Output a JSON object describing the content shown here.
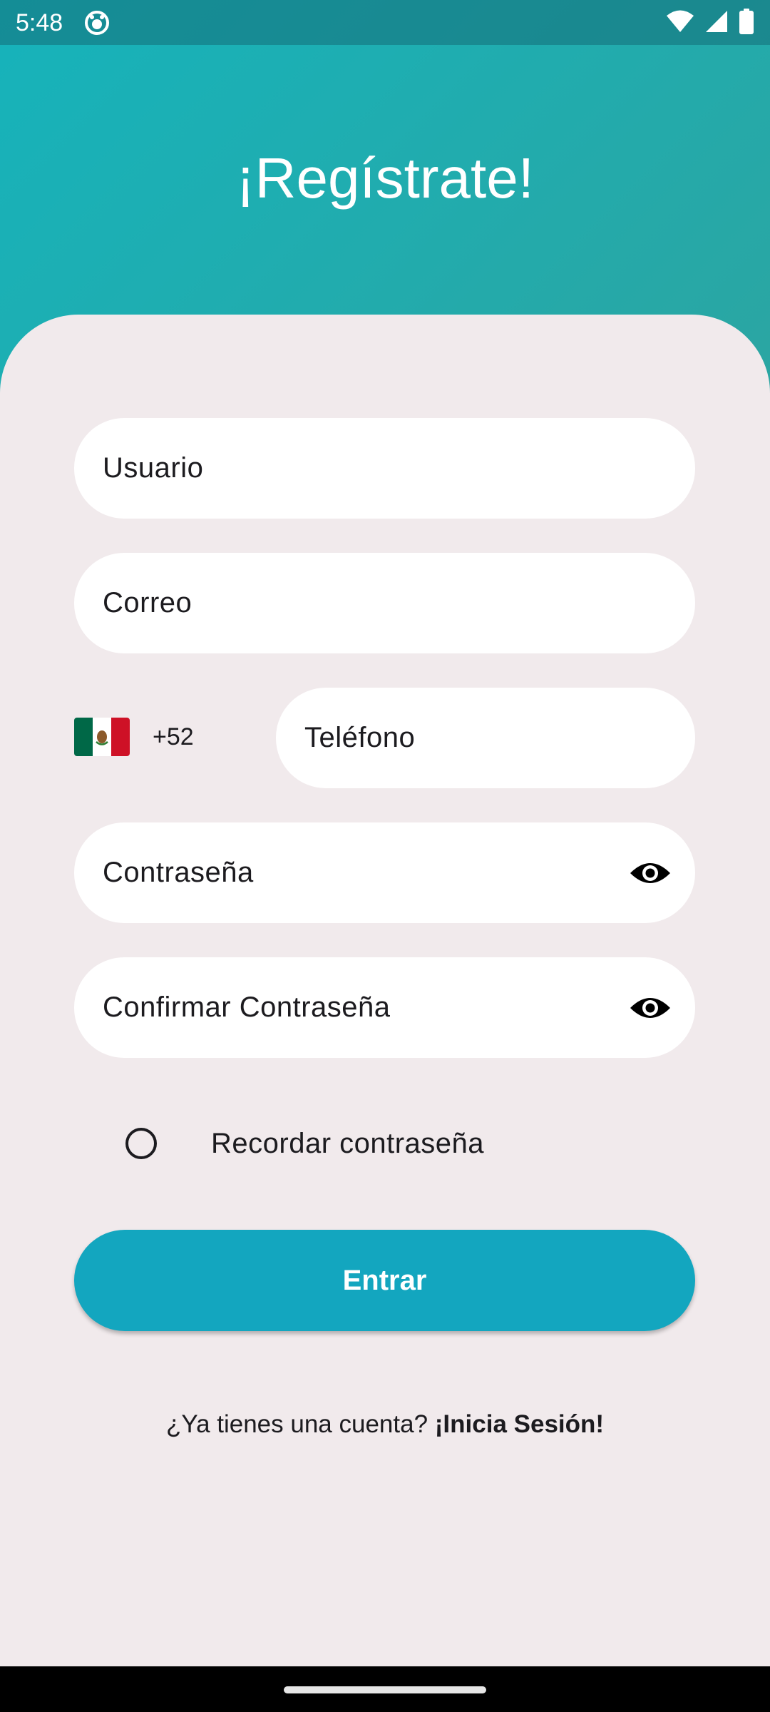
{
  "status_bar": {
    "time": "5:48",
    "icons": [
      "app-notification-icon",
      "wifi-icon",
      "signal-icon",
      "battery-icon"
    ]
  },
  "header": {
    "title": "¡Regístrate!"
  },
  "form": {
    "username_placeholder": "Usuario",
    "email_placeholder": "Correo",
    "country": {
      "flag": "mexico-flag-icon",
      "dial_code": "+52"
    },
    "phone_placeholder": "Teléfono",
    "password_placeholder": "Contraseña",
    "confirm_password_placeholder": "Confirmar Contraseña",
    "remember_label": "Recordar contraseña",
    "remember_checked": false,
    "submit_label": "Entrar"
  },
  "footer": {
    "prompt": "¿Ya tienes una cuenta?",
    "link_label": "¡Inicia Sesión!"
  },
  "colors": {
    "gradient_start": "#16b3bb",
    "gradient_end": "#47a088",
    "card_background": "#f1eaec",
    "button": "#13a6bf",
    "field_background": "#ffffff"
  }
}
